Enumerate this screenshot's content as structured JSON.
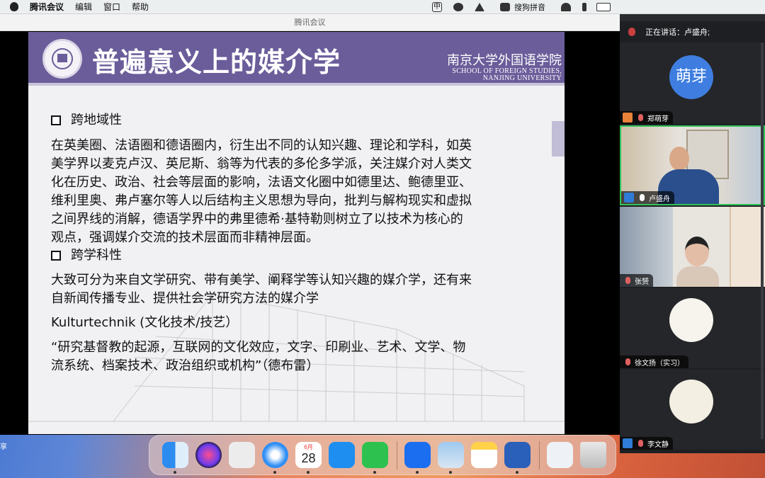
{
  "menubar": {
    "app_name": "腾讯会议",
    "items": [
      "编辑",
      "窗口",
      "帮助"
    ],
    "status": {
      "input_method": "搜狗拼音",
      "ime_badge": "中"
    }
  },
  "window": {
    "title": "腾讯会议"
  },
  "slide": {
    "title": "普遍意义上的媒介学",
    "school_cn": "南京大学外国语学院",
    "school_en_line1": "SCHOOL OF FOREIGN STUDIES,",
    "school_en_line2": "NANJING UNIVERSITY",
    "sections": [
      {
        "heading": "跨地域性",
        "lines": [
          "在英美圈、法语圈和德语圈内，衍生出不同的认知兴趣、理论和学科，如英",
          "美学界以麦克卢汉、英尼斯、翁等为代表的多伦多学派，关注媒介对人类文",
          "化在历史、政治、社会等层面的影响，法语文化圈中如德里达、鲍德里亚、",
          "维利里奥、弗卢塞尔等人以后结构主义思想为导向，批判与解构现实和虚拟",
          "之间界线的消解，德语学界中的弗里德希·基特勒则树立了以技术为核心的",
          "观点，强调媒介交流的技术层面而非精神层面。"
        ]
      },
      {
        "heading": "跨学科性",
        "lines": [
          "大致可分为来自文学研究、带有美学、阐释学等认知兴趣的媒介学，还有来",
          "自新闻传播专业、提供社会学研究方法的媒介学"
        ]
      }
    ],
    "kulturtechnik": "Kulturtechnik (文化技术/技艺）",
    "quote_lines": [
      "“研究基督教的起源，互联网的文化效应，文字、印刷业、艺术、文学、物",
      "流系统、档案技术、政治组织或机构”（德布雷）"
    ]
  },
  "share_label": "享",
  "participants": {
    "speaking_label": "正在讲话：卢盛舟;",
    "tiles": [
      {
        "name": "郑萌芽",
        "avatar_text": "萌芽",
        "type": "avatar"
      },
      {
        "name": "卢盛舟",
        "type": "video"
      },
      {
        "name": "张赟",
        "type": "video"
      },
      {
        "name": "徐文扬（实习）",
        "type": "picture"
      },
      {
        "name": "李文静",
        "type": "picture"
      }
    ]
  },
  "dock": {
    "calendar_month": "6月",
    "calendar_day": "28",
    "apps": [
      "finder-icon",
      "siri-icon",
      "launchpad-icon",
      "safari-icon",
      "calendar-icon",
      "appstore-icon",
      "wechat-icon",
      "tencent-meeting-icon",
      "preview-icon",
      "notes-icon",
      "word-icon",
      "downloads-icon",
      "trash-icon"
    ]
  },
  "colors": {
    "slide_header": "#6b5d9a",
    "active_border": "#32c25a",
    "accent_blue": "#3f7ee0"
  }
}
